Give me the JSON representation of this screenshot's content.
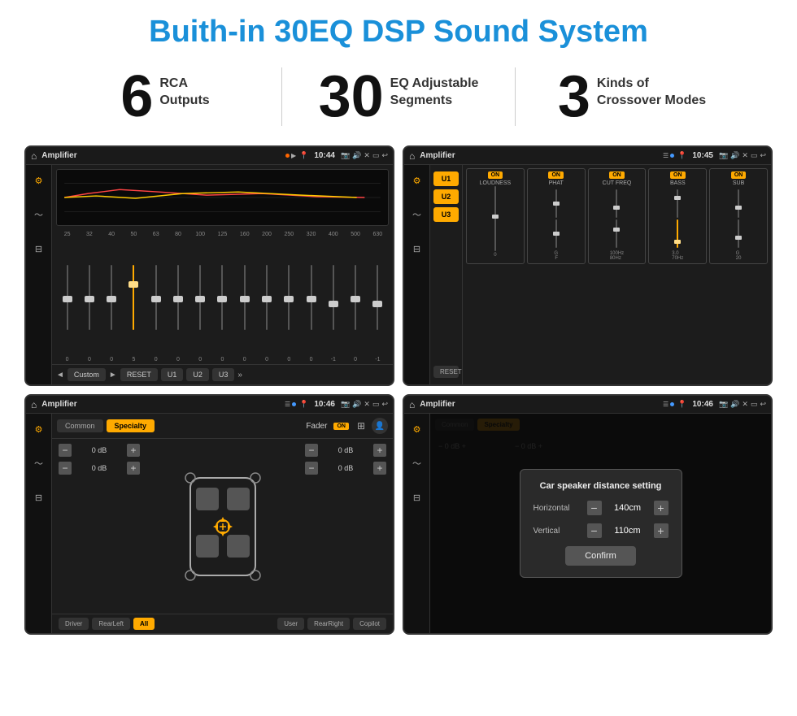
{
  "page": {
    "title": "Buith-in 30EQ DSP Sound System",
    "background": "#ffffff"
  },
  "stats": [
    {
      "number": "6",
      "text": "RCA\nOutputs"
    },
    {
      "number": "30",
      "text": "EQ Adjustable\nSegments"
    },
    {
      "number": "3",
      "text": "Kinds of\nCrossover Modes"
    }
  ],
  "screens": {
    "eq": {
      "title": "Amplifier",
      "time": "10:44",
      "frequencies": [
        "25",
        "32",
        "40",
        "50",
        "63",
        "80",
        "100",
        "125",
        "160",
        "200",
        "250",
        "320",
        "400",
        "500",
        "630"
      ],
      "values": [
        "0",
        "0",
        "0",
        "5",
        "0",
        "0",
        "0",
        "0",
        "0",
        "0",
        "0",
        "0",
        "-1",
        "0",
        "-1"
      ],
      "controls": [
        "◄",
        "Custom",
        "►",
        "RESET",
        "U1",
        "U2",
        "U3"
      ]
    },
    "crossover": {
      "title": "Amplifier",
      "time": "10:45",
      "presets": [
        "U1",
        "U2",
        "U3"
      ],
      "channels": [
        "LOUDNESS",
        "PHAT",
        "CUT FREQ",
        "BASS",
        "SUB"
      ],
      "on_label": "ON",
      "reset_label": "RESET"
    },
    "fader": {
      "title": "Amplifier",
      "time": "10:46",
      "tabs": [
        "Common",
        "Specialty"
      ],
      "fader_label": "Fader",
      "on_label": "ON",
      "buttons": [
        "Driver",
        "RearLeft",
        "All",
        "User",
        "RearRight",
        "Copilot"
      ]
    },
    "dialog": {
      "title": "Amplifier",
      "time": "10:46",
      "dialog_title": "Car speaker distance setting",
      "horizontal_label": "Horizontal",
      "horizontal_value": "140cm",
      "vertical_label": "Vertical",
      "vertical_value": "110cm",
      "confirm_label": "Confirm"
    }
  }
}
